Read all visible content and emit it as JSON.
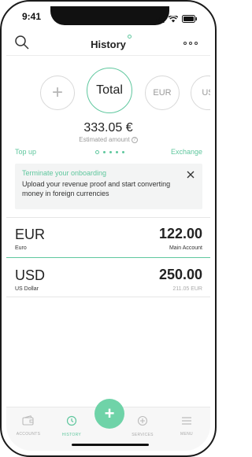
{
  "status_bar": {
    "time": "9:41"
  },
  "header": {
    "title": "History"
  },
  "carousel": {
    "add_symbol": "+",
    "selected": "Total",
    "currencies": [
      "EUR",
      "US"
    ]
  },
  "balance": {
    "amount": "333.05 €",
    "label": "Estimated amount",
    "info_symbol": "?"
  },
  "actions": {
    "top_up": "Top up",
    "exchange": "Exchange"
  },
  "pager": {
    "count": 5,
    "active_index": 0
  },
  "banner": {
    "title": "Terminate your onboarding",
    "text": "Upload your revenue proof and start converting money in foreign currencies"
  },
  "accounts": [
    {
      "code": "EUR",
      "name": "Euro",
      "amount": "122.00",
      "subtitle": "Main Account"
    },
    {
      "code": "USD",
      "name": "US Dollar",
      "amount": "250.00",
      "subtitle": "211.05 EUR"
    }
  ],
  "tabbar": {
    "tabs": [
      {
        "label": "ACCOUNTS",
        "icon": "wallet-icon"
      },
      {
        "label": "HISTORY",
        "icon": "history-icon"
      },
      {
        "label": "SERVICES",
        "icon": "services-icon"
      },
      {
        "label": "MENU",
        "icon": "menu-icon"
      }
    ],
    "fab_symbol": "+"
  },
  "colors": {
    "accent": "#5fc79e",
    "fab": "#6fd3a8"
  }
}
